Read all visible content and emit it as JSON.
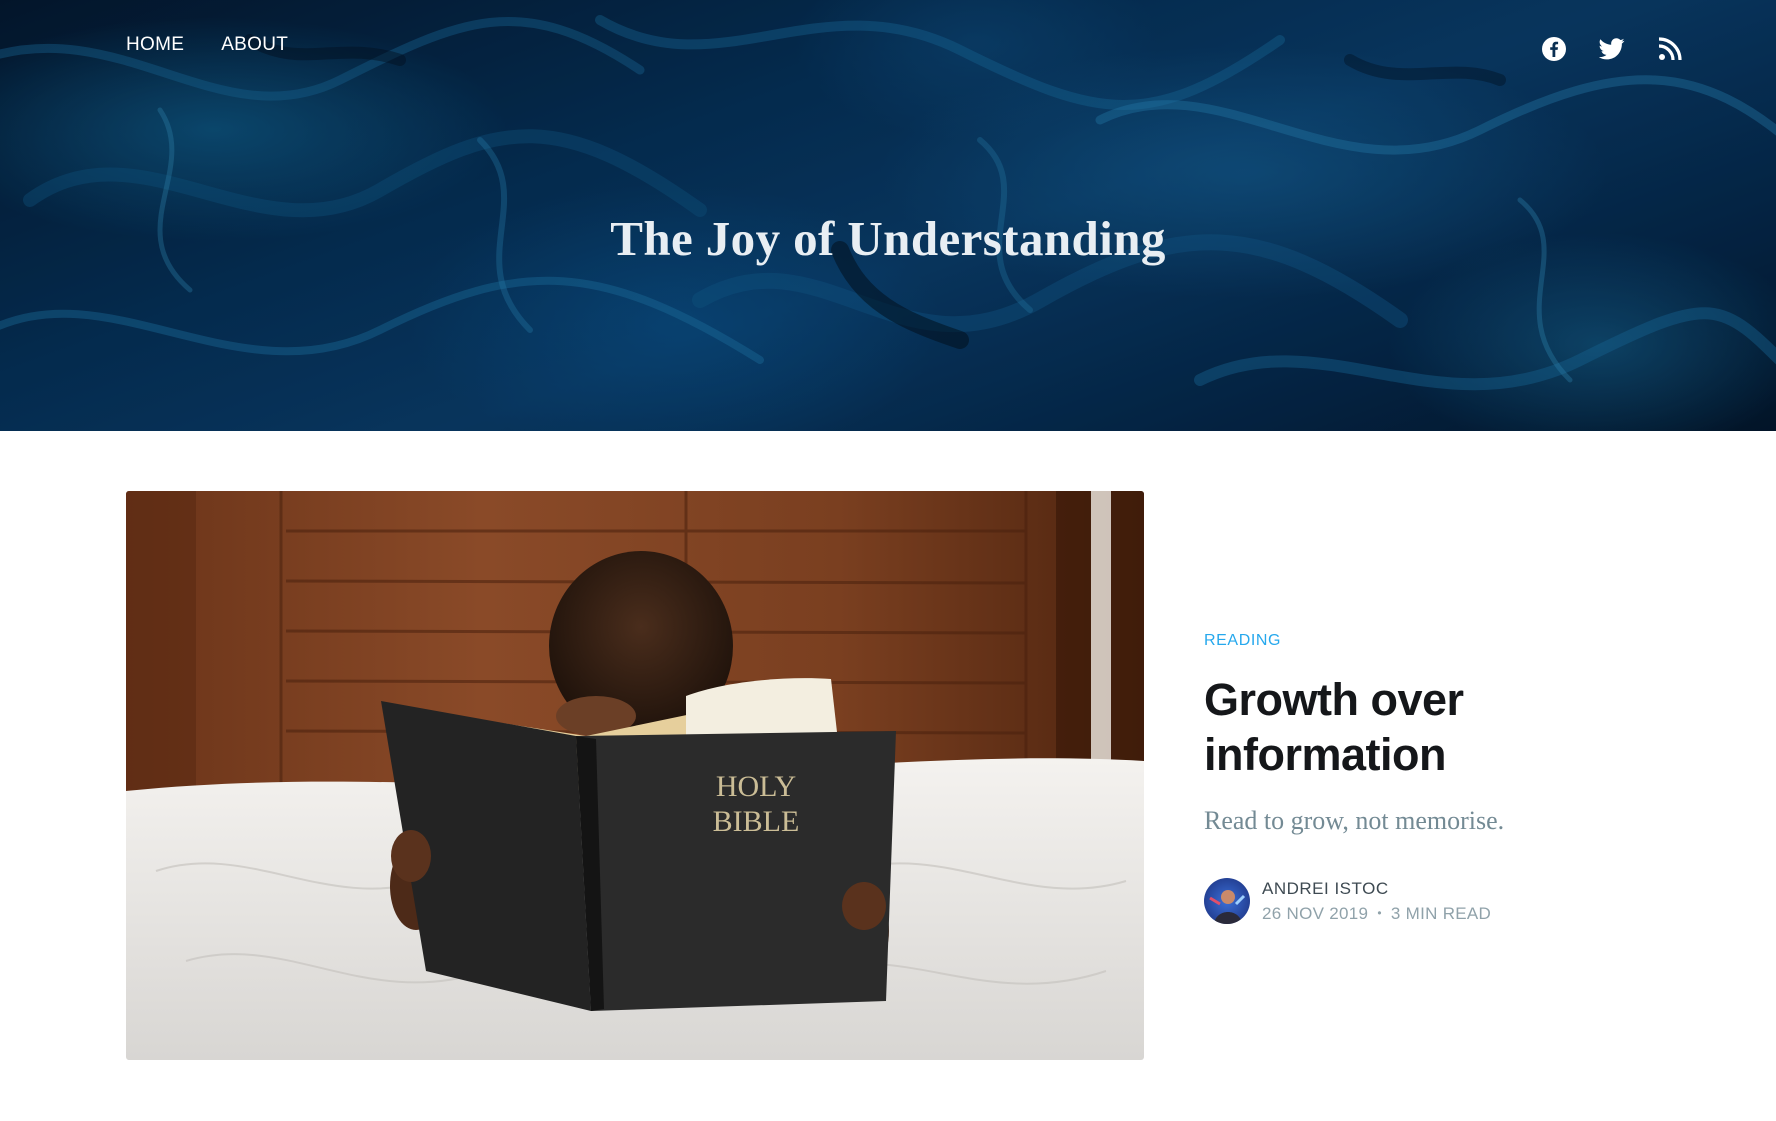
{
  "nav": {
    "items": [
      {
        "label": "HOME"
      },
      {
        "label": "ABOUT"
      }
    ]
  },
  "social": {
    "icons": [
      "facebook-icon",
      "twitter-icon",
      "rss-icon"
    ]
  },
  "hero": {
    "title": "The Joy of Understanding"
  },
  "featured_post": {
    "tag": "READING",
    "title": "Growth over information",
    "excerpt": "Read to grow, not memorise.",
    "image_text": "HOLY BIBLE",
    "author": "ANDREI ISTOC",
    "date": "26 NOV 2019",
    "separator": "•",
    "reading_time": "3 MIN READ"
  },
  "colors": {
    "accent": "#26a8ed",
    "title": "#15171a",
    "excerpt": "#738a94",
    "meta": "#90a2aa",
    "hero_dark": "#063259"
  }
}
